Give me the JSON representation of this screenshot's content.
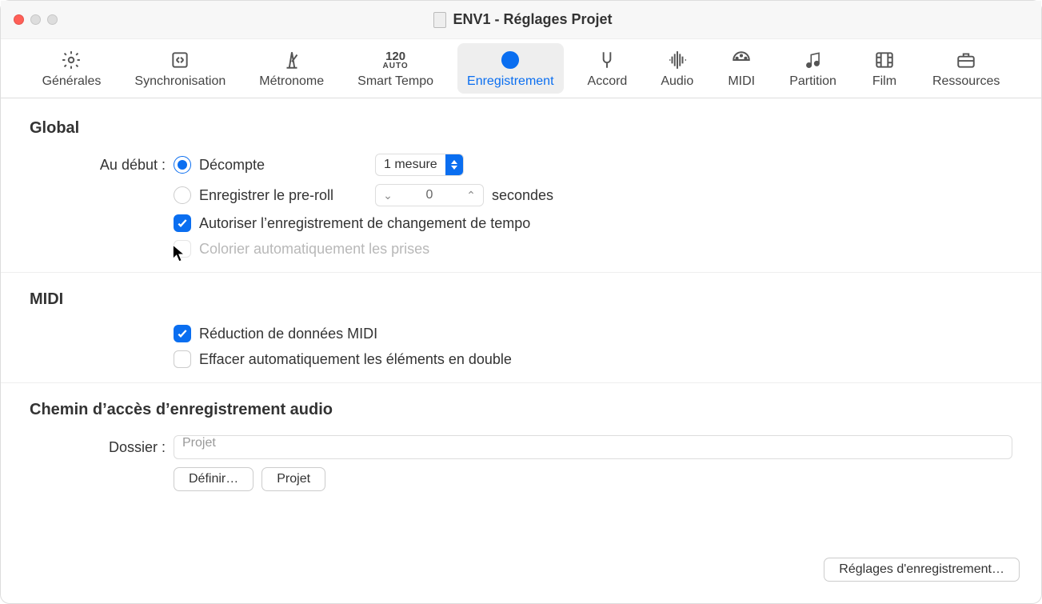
{
  "window": {
    "title": "ENV1 - Réglages Projet"
  },
  "tabs": [
    {
      "id": "generales",
      "label": "Générales"
    },
    {
      "id": "sync",
      "label": "Synchronisation"
    },
    {
      "id": "metronome",
      "label": "Métronome"
    },
    {
      "id": "smarttempo",
      "label": "Smart Tempo",
      "tempo": "120",
      "auto": "AUTO"
    },
    {
      "id": "enreg",
      "label": "Enregistrement",
      "selected": true
    },
    {
      "id": "accord",
      "label": "Accord"
    },
    {
      "id": "audio",
      "label": "Audio"
    },
    {
      "id": "midi",
      "label": "MIDI"
    },
    {
      "id": "partition",
      "label": "Partition"
    },
    {
      "id": "film",
      "label": "Film"
    },
    {
      "id": "ressources",
      "label": "Ressources"
    }
  ],
  "sections": {
    "global": {
      "title": "Global",
      "au_debut_label": "Au début :",
      "decompte": {
        "label": "Décompte",
        "checked": true,
        "dropdown": "1 mesure"
      },
      "preroll": {
        "label": "Enregistrer le pre-roll",
        "checked": false,
        "value": "0",
        "unit": "secondes"
      },
      "tempo_change": {
        "label": "Autoriser l’enregistrement de changement de tempo",
        "checked": true
      },
      "color_prises": {
        "label": "Colorier automatiquement les prises",
        "checked": false,
        "disabled": true
      }
    },
    "midi": {
      "title": "MIDI",
      "reduction": {
        "label": "Réduction de données MIDI",
        "checked": true
      },
      "effacer": {
        "label": "Effacer automatiquement les éléments en double",
        "checked": false
      }
    },
    "chemin": {
      "title": "Chemin d’accès d’enregistrement audio",
      "dossier_label": "Dossier :",
      "dossier_value": "Projet",
      "btn_definir": "Définir…",
      "btn_projet": "Projet"
    }
  },
  "footer_btn": "Réglages d'enregistrement…"
}
